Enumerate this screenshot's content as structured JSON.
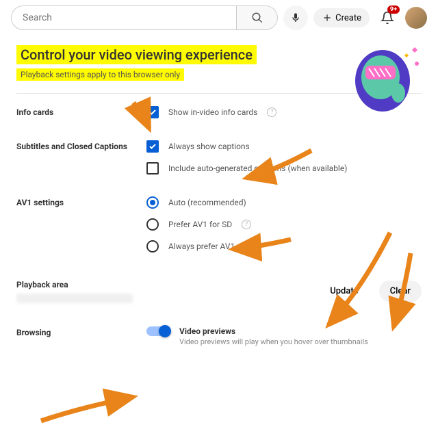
{
  "header": {
    "search_placeholder": "Search",
    "create_label": "Create",
    "notif_count": "9+"
  },
  "hero": {
    "title": "Control your video viewing experience",
    "subtitle": "Playback settings apply to this browser only"
  },
  "sections": {
    "info_cards": {
      "label": "Info cards",
      "opt1": "Show in-video info cards"
    },
    "captions": {
      "label": "Subtitles and Closed Captions",
      "opt1": "Always show captions",
      "opt2": "Include auto-generated captions (when available)"
    },
    "av1": {
      "label": "AV1 settings",
      "opt1": "Auto (recommended)",
      "opt2": "Prefer AV1 for SD",
      "opt3": "Always prefer AV1"
    },
    "playback": {
      "label": "Playback area",
      "update": "Update",
      "clear": "Clear"
    },
    "browsing": {
      "label": "Browsing",
      "toggle_title": "Video previews",
      "toggle_sub": "Video previews will play when you hover over thumbnails"
    }
  }
}
